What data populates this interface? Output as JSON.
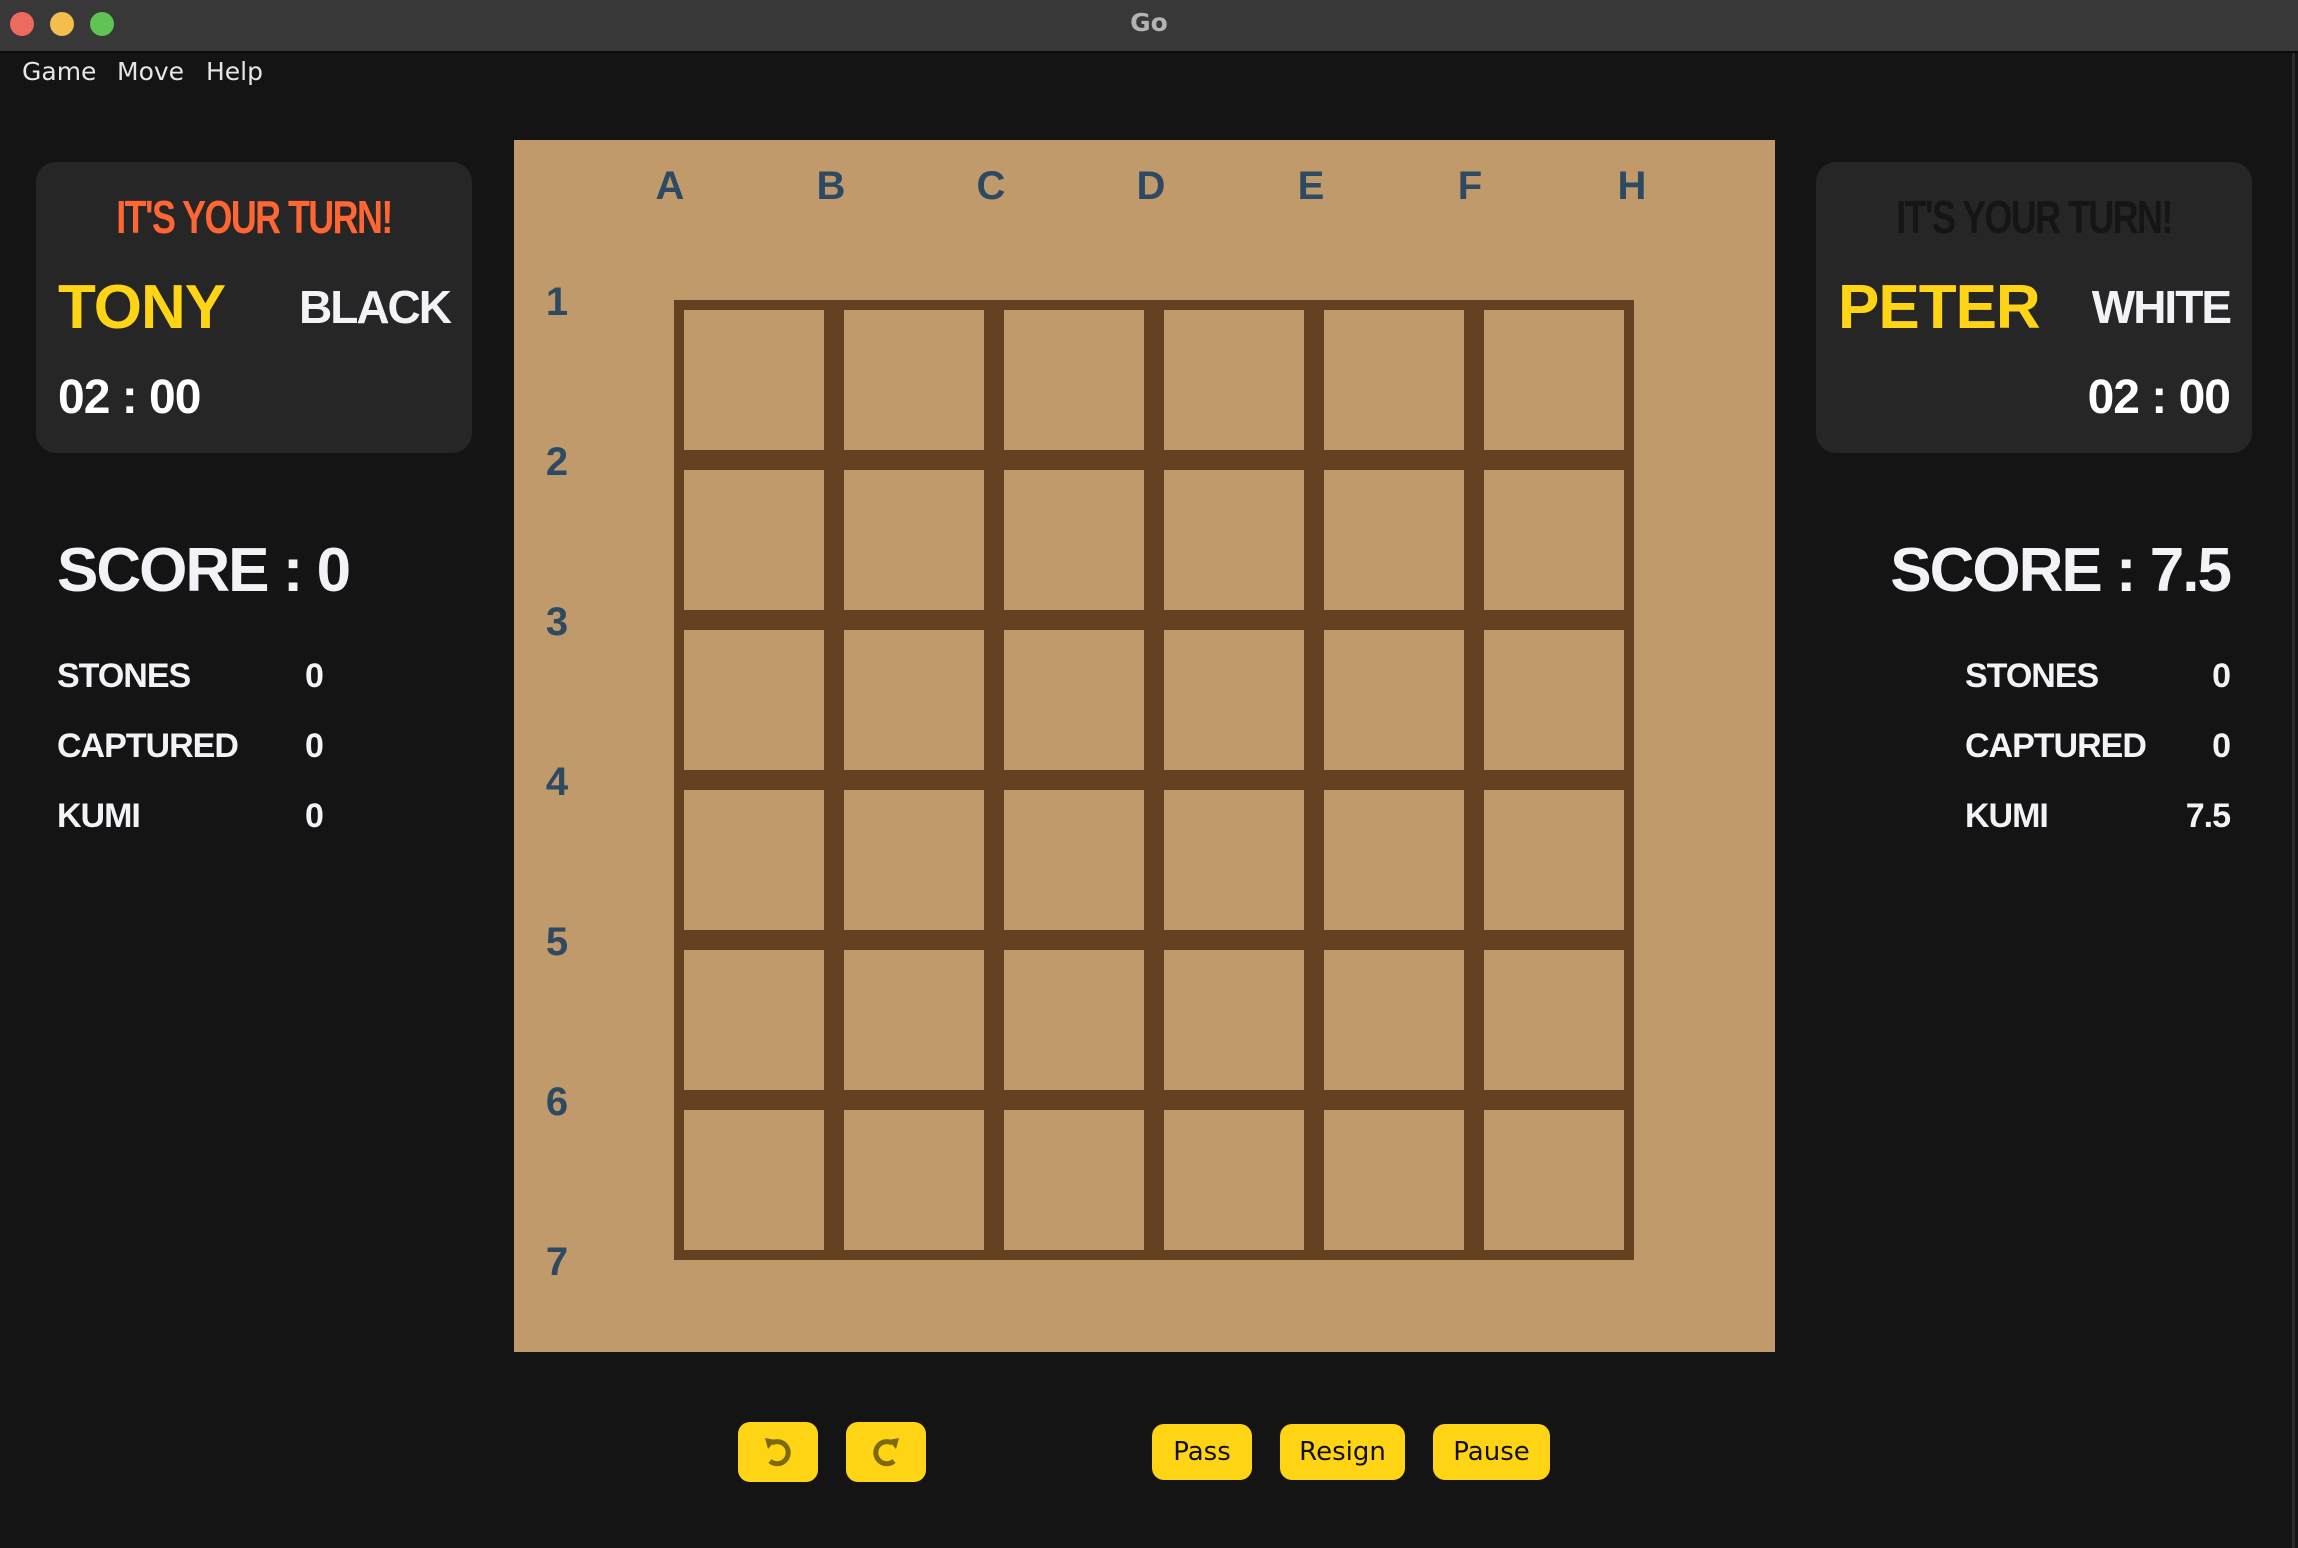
{
  "window": {
    "title": "Go"
  },
  "menu": [
    "Game",
    "Move",
    "Help"
  ],
  "colors": {
    "accent": "#ffd414",
    "turn_active": "#ff6633",
    "turn_inactive": "#151515",
    "board": "#c09a6b",
    "grid": "#634121",
    "label": "#2e4a62"
  },
  "player1": {
    "turn_text": "IT'S YOUR TURN!",
    "turn_active": true,
    "name": "TONY",
    "color": "BLACK",
    "timer": "02 : 00",
    "score": "SCORE : 0",
    "stats": [
      {
        "label": "STONES",
        "value": "0"
      },
      {
        "label": "CAPTURED",
        "value": "0"
      },
      {
        "label": "KUMI",
        "value": "0"
      }
    ]
  },
  "player2": {
    "turn_text": "IT'S YOUR TURN!",
    "turn_active": false,
    "name": "PETER",
    "color": "WHITE",
    "timer": "02 : 00",
    "score": "SCORE : 7.5",
    "stats": [
      {
        "label": "STONES",
        "value": "0"
      },
      {
        "label": "CAPTURED",
        "value": "0"
      },
      {
        "label": "KUMI",
        "value": "7.5"
      }
    ]
  },
  "board": {
    "columns": [
      "A",
      "B",
      "C",
      "D",
      "E",
      "F",
      "H"
    ],
    "rows": [
      "1",
      "2",
      "3",
      "4",
      "5",
      "6",
      "7"
    ]
  },
  "controls": {
    "undo_icon": "undo-arrow",
    "redo_icon": "redo-arrow",
    "pass": "Pass",
    "resign": "Resign",
    "pause": "Pause"
  }
}
